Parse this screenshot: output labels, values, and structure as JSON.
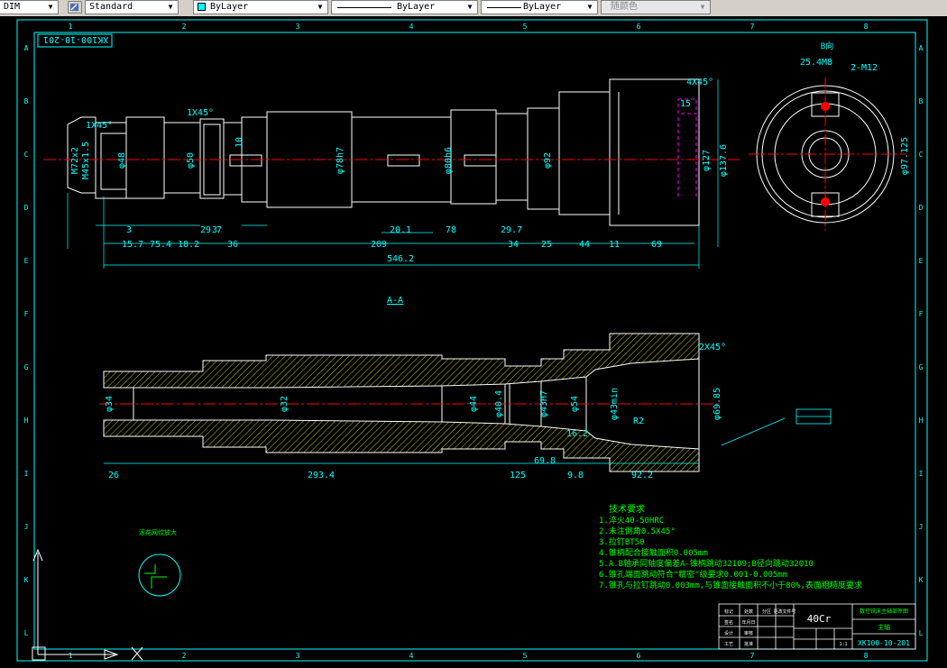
{
  "toolbar": {
    "dim_style": "DIM",
    "text_style": "Standard",
    "layer_color": "ByLayer",
    "linetype": "ByLayer",
    "lineweight": "ByLayer",
    "plot_style": "随颜色"
  },
  "colors": {
    "background": "#000000",
    "frame": "#00ffff",
    "dimension": "#00ffff",
    "outline": "#ffffff",
    "hatch": "#ffff00",
    "center_line": "#ff0000",
    "annotation": "#00ff00",
    "keyway": "#ff00ff",
    "swatch": "#00ffff"
  },
  "drawing": {
    "title_code_top": "XK100-10-201",
    "grid_columns": [
      "1",
      "2",
      "3",
      "4",
      "5",
      "6",
      "7",
      "8"
    ],
    "grid_rows": [
      "A",
      "B",
      "C",
      "D",
      "E",
      "F",
      "G",
      "H",
      "I",
      "J",
      "K",
      "L"
    ],
    "section_label": "A-A",
    "view_label_b": "B向",
    "dims_top_bottom": [
      "3",
      "15.7",
      "75.4",
      "3",
      "18.2",
      "29.7",
      "36",
      "209",
      "20.1",
      "78",
      "29.7",
      "34",
      "25",
      "44",
      "11",
      "69"
    ],
    "dim_overall": "546.2",
    "dims_top_misc": [
      "1X45°",
      "1X45°",
      "4X45°",
      "15",
      "φ50",
      "φ48",
      "φ78h7",
      "φ80h6",
      "φ92",
      "φ127",
      "φ137.6",
      "M72x2",
      "M45x1.5",
      "10"
    ],
    "dims_section": [
      "26",
      "293.4",
      "125",
      "9.8",
      "92.2",
      "69.8",
      "2X45°",
      "φ69.85",
      "φ32",
      "φ44",
      "φ40.4",
      "φ43H7",
      "φ54",
      "φ43min",
      "φ34",
      "R2",
      "16.2"
    ],
    "dims_bview": [
      "25.4M8",
      "2-M12",
      "φ97.125"
    ],
    "tech_requirements_title": "技术要求",
    "tech_requirements": [
      "1.淬火40-50HRC",
      "2.未注倒角0.5X45°",
      "3.拉钉BT50",
      "4.锥柄配合接触面积0.005mm",
      "5.A.B轴承同轴度偏差A-锥柄跳动32109;B径向跳动32010",
      "6.锥孔端面跳动符合\"精密\"级要求0.001-0.005mm",
      "7.锥孔与拉钉跳动0.003mm,与锥面接触面积不小于80%,表面粗糙度要求"
    ],
    "detail_note": "滚花网纹放大",
    "material": "40Cr",
    "drawing_number": "XK100-10-201",
    "part_name": "主轴",
    "company": "数控铣床主轴部件图",
    "title_block_small": [
      "标记",
      "处数",
      "分区",
      "更改文件号",
      "签名",
      "年月日",
      "设计",
      "审核",
      "工艺",
      "批准",
      "1:1"
    ]
  }
}
